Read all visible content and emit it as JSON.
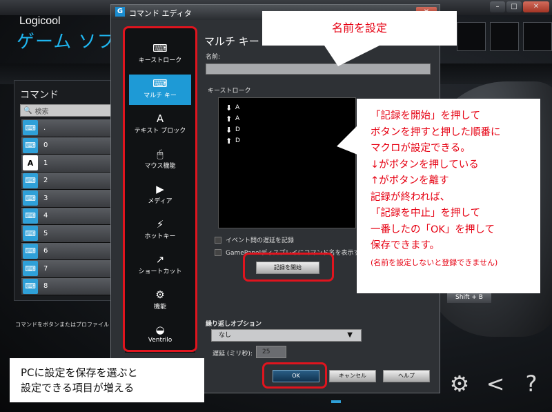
{
  "app": {
    "brand": "Logicool",
    "title": "ゲーム ソフトウ",
    "command_panel_title": "コマンド",
    "search_placeholder": "検索",
    "commands": [
      {
        "label": ".",
        "icon": "key-icon"
      },
      {
        "label": "0",
        "icon": "key-icon"
      },
      {
        "label": "1",
        "icon": "text-block-icon"
      },
      {
        "label": "2",
        "icon": "multikey-icon"
      },
      {
        "label": "3",
        "icon": "key-icon"
      },
      {
        "label": "4",
        "icon": "key-icon"
      },
      {
        "label": "5",
        "icon": "key-icon"
      },
      {
        "label": "6",
        "icon": "key-icon"
      },
      {
        "label": "7",
        "icon": "key-icon"
      },
      {
        "label": "8",
        "icon": "key-icon"
      }
    ],
    "footer_text": "コマンドをボタンまたはプロファイル ア",
    "shift_label": "Shift + B"
  },
  "dialog": {
    "title": "コマンド エディタ",
    "categories": [
      {
        "label": "キーストローク",
        "icon": "keystroke-icon",
        "active": false
      },
      {
        "label": "マルチ キー",
        "icon": "multikey-icon",
        "active": true
      },
      {
        "label": "テキスト ブロック",
        "icon": "text-block-icon",
        "active": false
      },
      {
        "label": "マウス機能",
        "icon": "mouse-icon",
        "active": false
      },
      {
        "label": "メディア",
        "icon": "play-icon",
        "active": false
      },
      {
        "label": "ホットキー",
        "icon": "hotkey-icon",
        "active": false
      },
      {
        "label": "ショートカット",
        "icon": "shortcut-arrow-icon",
        "active": false
      },
      {
        "label": "機能",
        "icon": "function-icon",
        "active": false
      },
      {
        "label": "Ventrilo",
        "icon": "headset-icon",
        "active": false
      }
    ],
    "section_title": "マルチ キー",
    "name_label": "名前:",
    "name_value": "",
    "keystroke_label": "キーストローク",
    "keystrokes": [
      {
        "dir": "down",
        "key": "A"
      },
      {
        "dir": "up",
        "key": "A"
      },
      {
        "dir": "down",
        "key": "D"
      },
      {
        "dir": "up",
        "key": "D"
      }
    ],
    "option_delay": "イベント間の遅延を記録",
    "option_gamepanel": "GamePanelディスプレイにコマンド名を表示す",
    "record_button": "記録を開始",
    "repeat_label": "繰り返しオプション",
    "repeat_value": "なし",
    "delay_label": "遅延 (ミリ秒):",
    "delay_value": "25",
    "ok_button": "OK",
    "cancel_button": "キャンセル",
    "help_button": "ヘルプ"
  },
  "callouts": {
    "name_tip": "名前を設定",
    "record_tip": [
      "「記録を開始」を押して",
      "ボタンを押すと押した順番に",
      "マクロが設定できる。",
      "↓がボタンを押している",
      "↑がボタンを離す",
      "記録が終われば、",
      "「記録を中止」を押して",
      "一番したの「OK」を押して",
      "保存できます。"
    ],
    "record_tip_note": "(名前を設定しないと登録できません)",
    "pc_tip": [
      "PCに設定を保存を選ぶと",
      "設定できる項目が増える"
    ]
  },
  "colors": {
    "accent": "#1e9ad6",
    "highlight_red": "#e0141e",
    "callout_red": "#e60012"
  }
}
